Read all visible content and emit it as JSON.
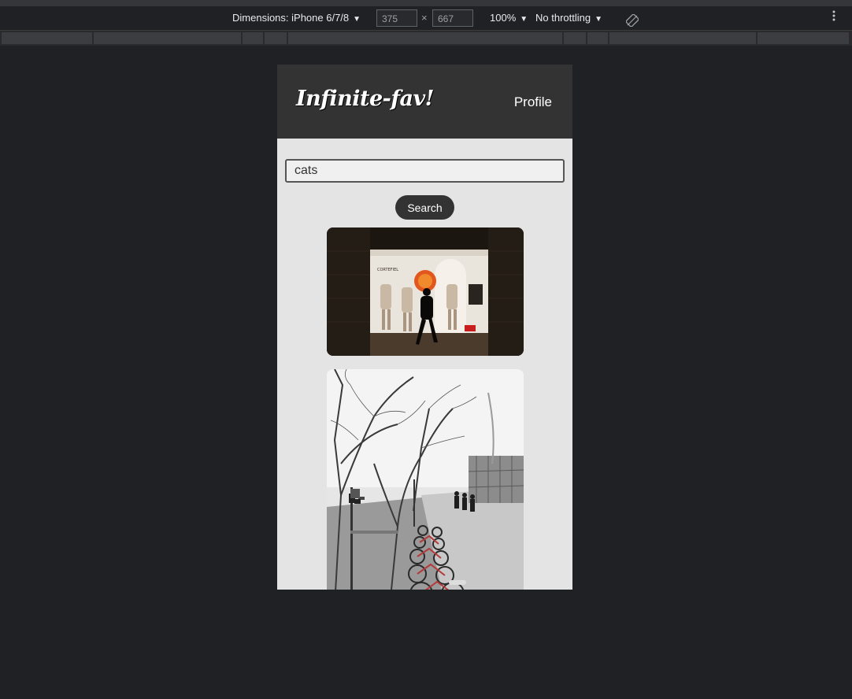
{
  "devtools": {
    "dimensions_label": "Dimensions: iPhone 6/7/8",
    "width_value": "375",
    "times_sign": "×",
    "height_value": "667",
    "zoom": "100%",
    "throttling": "No throttling",
    "caret": "▼",
    "more_icon": "more-vertical-icon",
    "rotate_icon": "rotate-icon"
  },
  "app": {
    "logo": "Infinite-fav!",
    "profile_link": "Profile",
    "header_color": "#333333",
    "background_color": "#e4e4e4"
  },
  "search": {
    "value": "cats",
    "button_label": "Search"
  },
  "results": [
    {
      "alt": "",
      "subject": "shop window with mannequins at night and walking silhouette"
    },
    {
      "alt": "",
      "subject": "black and white street with bare trees and row of bikes"
    }
  ]
}
